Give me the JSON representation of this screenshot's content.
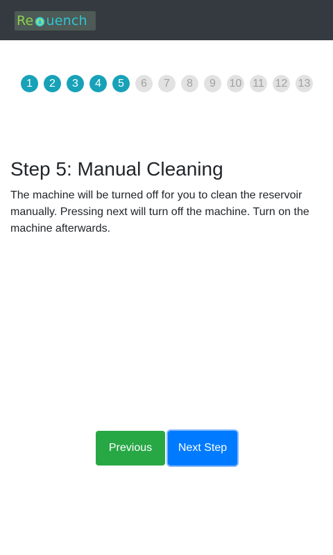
{
  "header": {
    "logo_text_a": "Re",
    "logo_text_b": "uench",
    "logo_icon": "water-drop-icon"
  },
  "stepper": {
    "current": 5,
    "total": 13,
    "steps": [
      "1",
      "2",
      "3",
      "4",
      "5",
      "6",
      "7",
      "8",
      "9",
      "10",
      "11",
      "12",
      "13"
    ],
    "colors": {
      "done": "#17a2b8",
      "todo": "#e2e2e2"
    }
  },
  "content": {
    "title": "Step 5: Manual Cleaning",
    "description": "The machine will be turned off for you to clean the reservoir manually. Pressing next will turn off the machine. Turn on the machine afterwards."
  },
  "actions": {
    "previous_label": "Previous",
    "next_label": "Next Step",
    "previous_color": "#28a745",
    "next_color": "#007bff"
  }
}
